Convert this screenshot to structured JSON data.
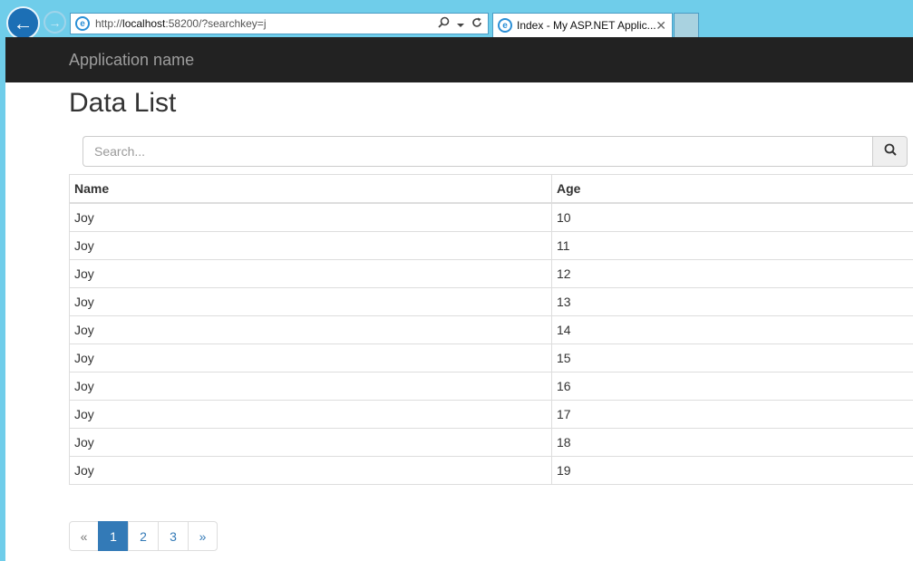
{
  "browser": {
    "url_prefix": "http://",
    "url_host": "localhost",
    "url_suffix": ":58200/?searchkey=j",
    "tab_title": "Index - My ASP.NET Applic...",
    "back_glyph": "←",
    "forward_glyph": "→",
    "close_glyph": "✕",
    "icons": [
      "back-arrow-icon",
      "forward-arrow-icon",
      "ie-icon",
      "search-icon",
      "dropdown-icon",
      "refresh-icon",
      "close-icon"
    ]
  },
  "navbar": {
    "brand": "Application name"
  },
  "page": {
    "title": "Data List"
  },
  "search": {
    "placeholder": "Search...",
    "value": ""
  },
  "table": {
    "headers": [
      "Name",
      "Age"
    ],
    "rows": [
      [
        "Joy",
        "10"
      ],
      [
        "Joy",
        "11"
      ],
      [
        "Joy",
        "12"
      ],
      [
        "Joy",
        "13"
      ],
      [
        "Joy",
        "14"
      ],
      [
        "Joy",
        "15"
      ],
      [
        "Joy",
        "16"
      ],
      [
        "Joy",
        "17"
      ],
      [
        "Joy",
        "18"
      ],
      [
        "Joy",
        "19"
      ]
    ]
  },
  "pagination": {
    "prev": "«",
    "pages": [
      "1",
      "2",
      "3"
    ],
    "active": "1",
    "next": "»"
  },
  "colors": {
    "accent": "#337ab7",
    "navbar": "#222222",
    "chrome": "#6fcdea"
  }
}
